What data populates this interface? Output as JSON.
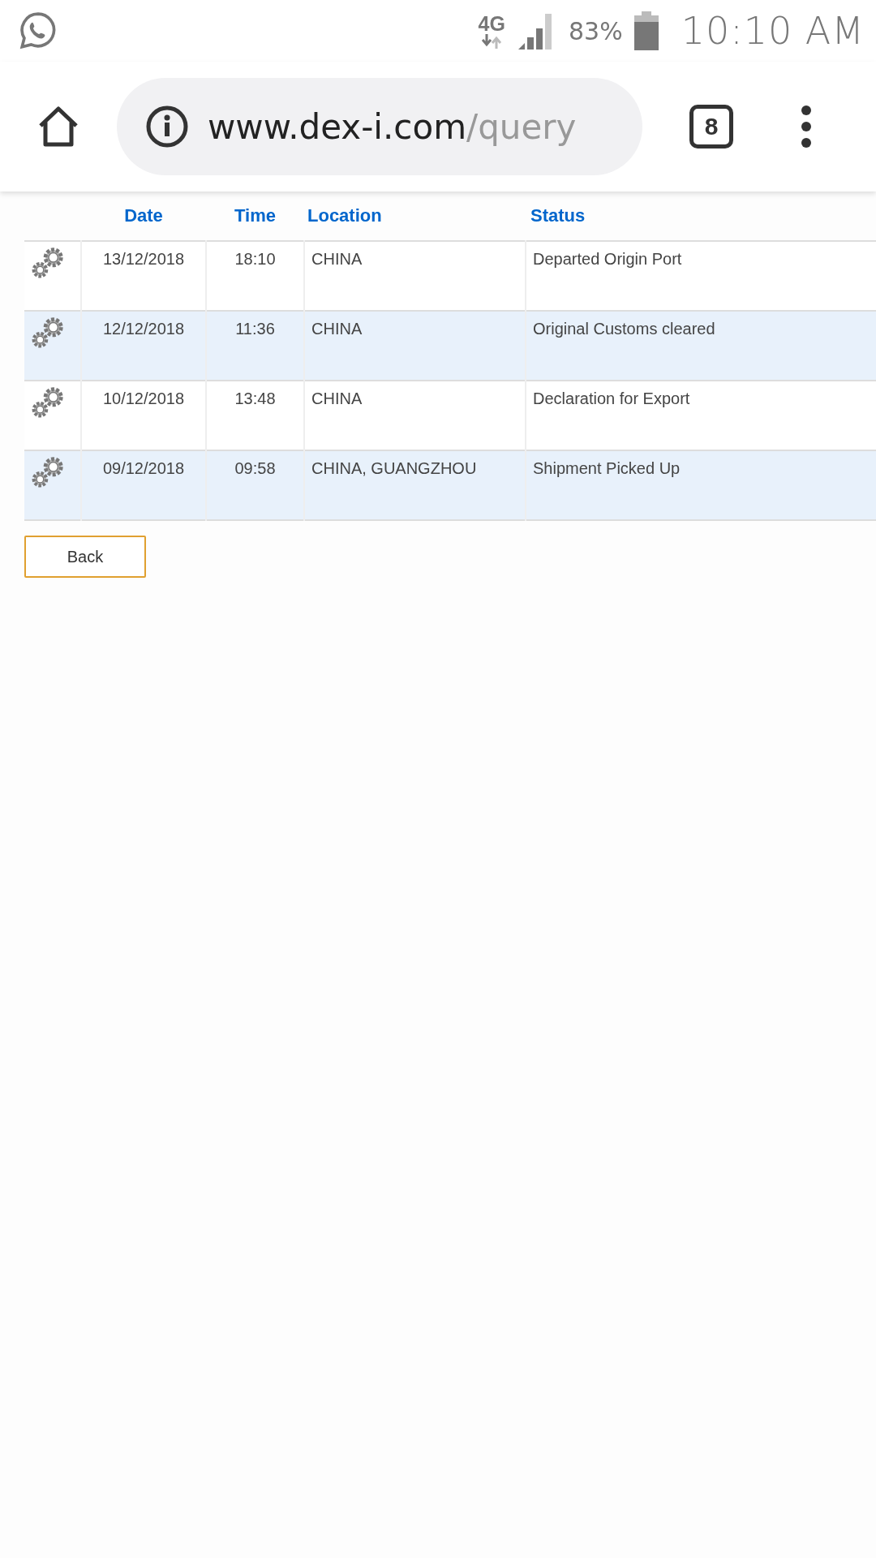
{
  "status_bar": {
    "network": "4G",
    "battery": "83%",
    "time": "10:10 AM"
  },
  "browser": {
    "url_host": "www.dex-i.com",
    "url_path": "/query",
    "tab_count": "8"
  },
  "table": {
    "columns": [
      "Date",
      "Time",
      "Location",
      "Status"
    ],
    "rows": [
      {
        "date": "13/12/2018",
        "time": "18:10",
        "location": "CHINA",
        "status": "Departed Origin Port"
      },
      {
        "date": "12/12/2018",
        "time": "11:36",
        "location": "CHINA",
        "status": "Original Customs cleared"
      },
      {
        "date": "10/12/2018",
        "time": "13:48",
        "location": "CHINA",
        "status": "Declaration for Export"
      },
      {
        "date": "09/12/2018",
        "time": "09:58",
        "location": "CHINA, GUANGZHOU",
        "status": "Shipment Picked Up"
      }
    ]
  },
  "back_button": "Back"
}
